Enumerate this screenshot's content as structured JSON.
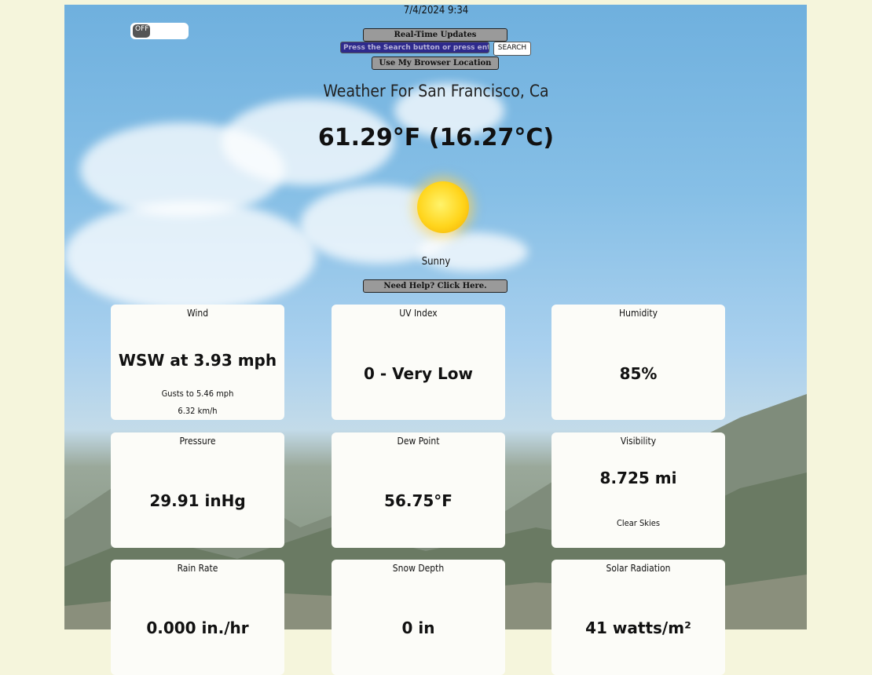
{
  "datetime": "7/4/2024 9:34",
  "toggle": {
    "label": "OFF"
  },
  "controls": {
    "realtime_label": "Real-Time Updates",
    "search_placeholder": "Press the Search button or press ent",
    "search_button": "SEARCH",
    "location_label": "Use My Browser Location",
    "help_label": "Need Help? Click Here."
  },
  "weather": {
    "title": "Weather For San Francisco, Ca",
    "temperature": "61.29°F (16.27°C)",
    "condition": "Sunny",
    "icon": "sun-icon"
  },
  "cards": {
    "wind": {
      "label": "Wind",
      "value": "WSW at 3.93 mph",
      "sub1": "Gusts to 5.46 mph",
      "sub2": "6.32 km/h"
    },
    "uv": {
      "label": "UV Index",
      "value": "0 - Very Low"
    },
    "humidity": {
      "label": "Humidity",
      "value": "85%"
    },
    "pressure": {
      "label": "Pressure",
      "value": "29.91 inHg"
    },
    "dewpoint": {
      "label": "Dew Point",
      "value": "56.75°F"
    },
    "visibility": {
      "label": "Visibility",
      "value": "8.725 mi",
      "sub1": "Clear Skies"
    },
    "rain": {
      "label": "Rain Rate",
      "value": "0.000 in./hr"
    },
    "snow": {
      "label": "Snow Depth",
      "value": "0 in"
    },
    "solar": {
      "label": "Solar Radiation",
      "value": "41 watts/m²"
    }
  }
}
